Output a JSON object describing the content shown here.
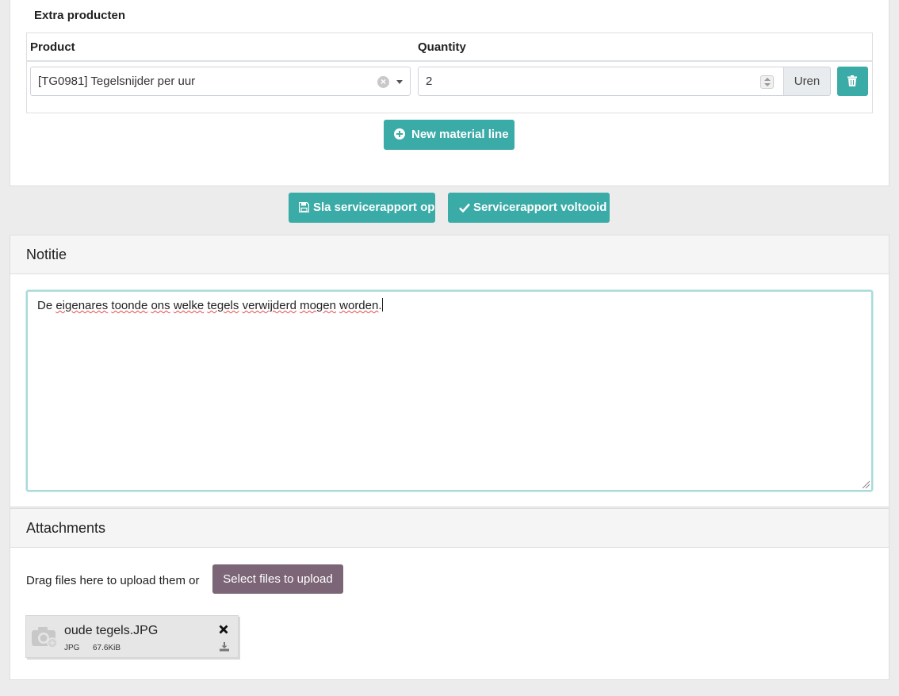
{
  "materials": {
    "section_title": "Extra producten",
    "col_product": "Product",
    "col_quantity": "Quantity",
    "rows": [
      {
        "product": "[TG0981] Tegelsnijder per uur",
        "quantity": "2",
        "unit": "Uren"
      }
    ],
    "new_line_label": "New material line"
  },
  "actions": {
    "save_label": "Sla servicerapport op",
    "complete_label": "Servicerapport voltooid"
  },
  "note": {
    "title": "Notitie",
    "text_words": [
      "De ",
      "eigenares",
      " ",
      "toonde",
      " ",
      "ons",
      " ",
      "welke",
      " ",
      "tegels",
      " ",
      "verwijderd",
      " ",
      "mogen",
      " ",
      "worden",
      "."
    ]
  },
  "attachments": {
    "title": "Attachments",
    "drag_text": "Drag files here to upload them or",
    "select_label": "Select files to upload",
    "files": [
      {
        "name": "oude tegels.JPG",
        "type": "JPG",
        "size": "67.6KiB"
      }
    ]
  },
  "colors": {
    "accent": "#3aaba7",
    "upload_button": "#7c6577",
    "focus_border": "#a8dbd8"
  },
  "icons": [
    "trash-icon",
    "plus-circle-icon",
    "floppy-disk-icon",
    "check-icon",
    "close-icon",
    "download-icon",
    "camera-icon",
    "clear-icon",
    "chevron-down-icon"
  ]
}
